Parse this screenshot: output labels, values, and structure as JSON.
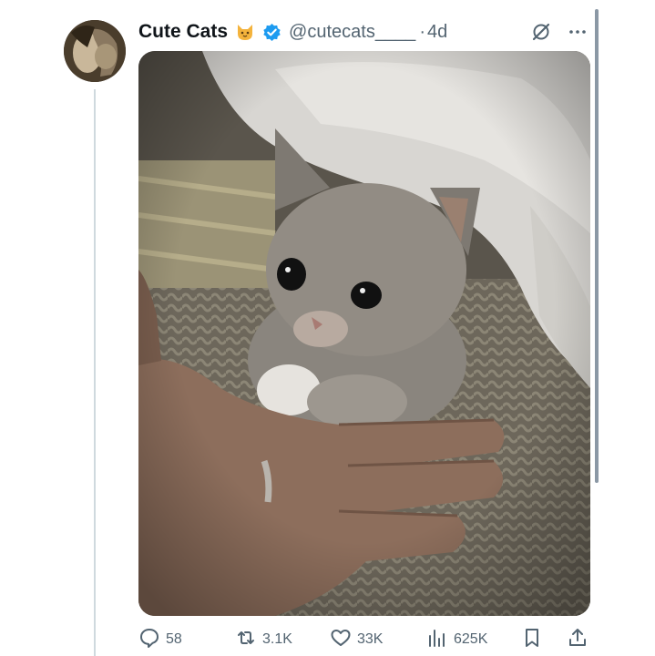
{
  "post": {
    "display_name": "Cute Cats",
    "handle": "@cutecats____",
    "separator": "·",
    "time": "4d",
    "avatar_alt": "profile photo with cat",
    "media_alt": "grey kitten sitting beside an open hand on a blanket"
  },
  "icons": {
    "name_emoji": "cat-face-icon",
    "verified": "verified-badge-icon",
    "grok": "grok-icon",
    "more": "more-icon",
    "reply": "reply-icon",
    "repost": "repost-icon",
    "like": "like-icon",
    "views": "views-icon",
    "bookmark": "bookmark-icon",
    "share": "share-icon"
  },
  "actions": {
    "replies": "58",
    "reposts": "3.1K",
    "likes": "33K",
    "views": "625K"
  },
  "colors": {
    "verified_blue": "#1d9bf0",
    "text_primary": "#0f1419",
    "text_secondary": "#536471",
    "thread_line": "#cfd9de"
  }
}
